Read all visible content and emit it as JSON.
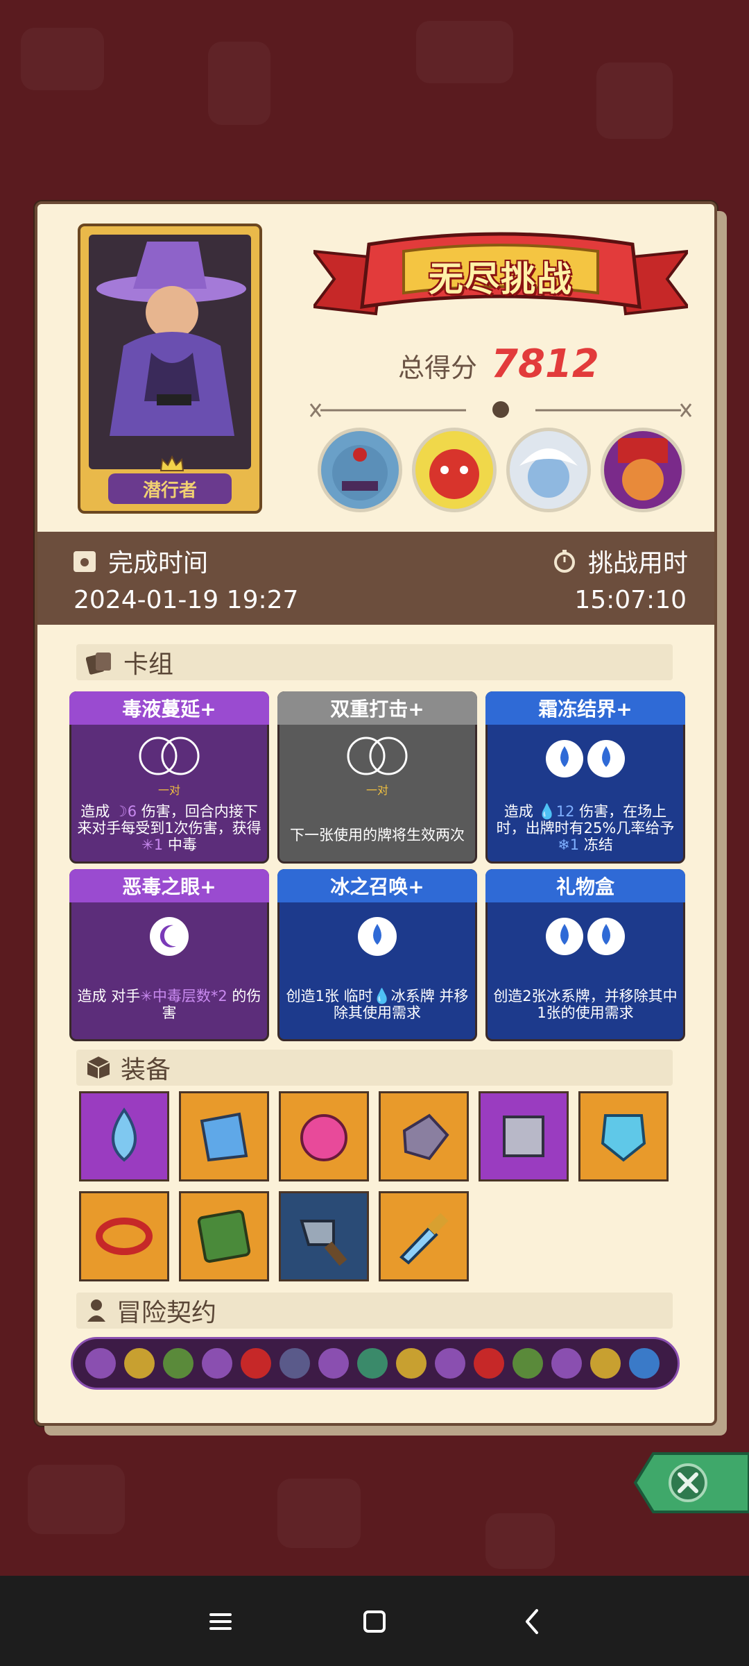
{
  "character": {
    "name": "潜行者"
  },
  "banner": {
    "title": "无尽挑战"
  },
  "score": {
    "label": "总得分",
    "value": "7812"
  },
  "bosses": [
    "blue-ogre",
    "red-demon",
    "white-haired-spirit",
    "masked-jester"
  ],
  "completion": {
    "label": "完成时间",
    "value": "2024-01-19 19:27"
  },
  "duration": {
    "label": "挑战用时",
    "value": "15:07:10"
  },
  "sections": {
    "deck": "卡组",
    "equipment": "装备",
    "contract": "冒险契约"
  },
  "cards": [
    {
      "title": "毒液蔓延+",
      "tag": "一对",
      "desc_a": "造成 ",
      "desc_num": "6",
      "desc_b": " 伤害，回合内接下来对手每受到1次伤害，获得 ",
      "desc_num2": "1",
      "desc_c": " 中毒"
    },
    {
      "title": "双重打击+",
      "tag": "一对",
      "desc": "下一张使用的牌将生效两次"
    },
    {
      "title": "霜冻结界+",
      "desc_a": "造成 ",
      "desc_num": "12",
      "desc_b": " 伤害，在场上时，出牌时有25%几率给予 ",
      "desc_num2": "1",
      "desc_c": " 冻结"
    },
    {
      "title": "恶毒之眼+",
      "desc_a": "造成 对手",
      "desc_hl": "中毒层数*2",
      "desc_b": " 的伤害"
    },
    {
      "title": "冰之召唤+",
      "desc_a": "创造1张 临时",
      "desc_b": "冰系牌 并移除其使用需求"
    },
    {
      "title": "礼物盒",
      "desc": "创造2张冰系牌，并移除其中1张的使用需求"
    }
  ],
  "equipment": [
    "water-drop-icon",
    "crystal-potion-icon",
    "fire-orb-icon",
    "moon-stone-icon",
    "ice-cube-icon",
    "frost-shield-icon",
    "spiked-ring-icon",
    "moss-tome-icon",
    "cleaver-icon",
    "ice-dagger-icon"
  ],
  "colors": {
    "accent": "#e23b3b",
    "panel": "#fbf1d8",
    "band": "#6c4e3d"
  }
}
